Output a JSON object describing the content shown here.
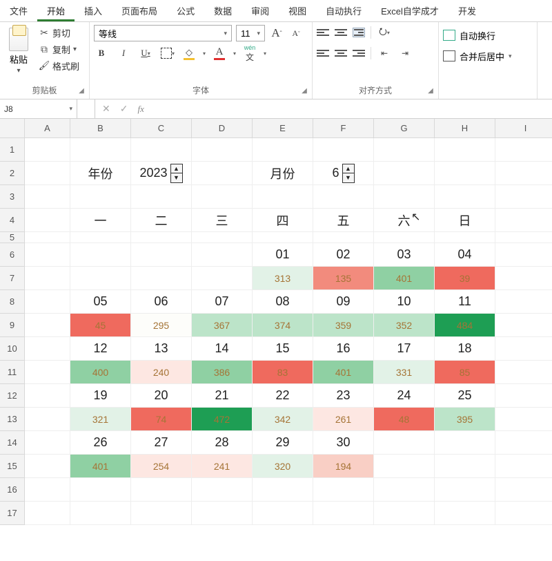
{
  "tabs": [
    "文件",
    "开始",
    "插入",
    "页面布局",
    "公式",
    "数据",
    "审阅",
    "视图",
    "自动执行",
    "Excel自学成才",
    "开发"
  ],
  "active_tab": "开始",
  "clipboard": {
    "paste": "粘贴",
    "cut": "剪切",
    "copy": "复制",
    "format_painter": "格式刷",
    "group": "剪贴板"
  },
  "font": {
    "name": "等线",
    "size": "11",
    "bold": "B",
    "italic": "I",
    "underline": "U",
    "wen": "wén",
    "wen2": "文",
    "group": "字体",
    "A": "A"
  },
  "align": {
    "group": "对齐方式",
    "wrap": "自动换行",
    "merge": "合并后居中"
  },
  "name_box": "J8",
  "fx_label": "fx",
  "columns": [
    "A",
    "B",
    "C",
    "D",
    "E",
    "F",
    "G",
    "H",
    "I"
  ],
  "rows": [
    "1",
    "2",
    "3",
    "4",
    "5",
    "6",
    "7",
    "8",
    "9",
    "10",
    "11",
    "12",
    "13",
    "14",
    "15",
    "16",
    "17"
  ],
  "sheet": {
    "year_label": "年份",
    "year_value": "2023",
    "month_label": "月份",
    "month_value": "6",
    "weekdays": [
      "一",
      "二",
      "三",
      "四",
      "五",
      "六",
      "日"
    ]
  },
  "calendar": [
    {
      "days": [
        "",
        "",
        "",
        "01",
        "02",
        "03",
        "04"
      ],
      "vals": [
        null,
        null,
        null,
        {
          "v": "313",
          "c": "g1"
        },
        {
          "v": "135",
          "c": "r4"
        },
        {
          "v": "401",
          "c": "g3"
        },
        {
          "v": "39",
          "c": "r5"
        }
      ]
    },
    {
      "days": [
        "05",
        "06",
        "07",
        "08",
        "09",
        "10",
        "11"
      ],
      "vals": [
        {
          "v": "45",
          "c": "r5"
        },
        {
          "v": "295",
          "c": "w0"
        },
        {
          "v": "367",
          "c": "g2"
        },
        {
          "v": "374",
          "c": "g2"
        },
        {
          "v": "359",
          "c": "g2"
        },
        {
          "v": "352",
          "c": "g2"
        },
        {
          "v": "484",
          "c": "g5"
        }
      ]
    },
    {
      "days": [
        "12",
        "13",
        "14",
        "15",
        "16",
        "17",
        "18"
      ],
      "vals": [
        {
          "v": "400",
          "c": "g3"
        },
        {
          "v": "240",
          "c": "r1"
        },
        {
          "v": "386",
          "c": "g3"
        },
        {
          "v": "83",
          "c": "r5"
        },
        {
          "v": "401",
          "c": "g3"
        },
        {
          "v": "331",
          "c": "g1"
        },
        {
          "v": "85",
          "c": "r5"
        }
      ]
    },
    {
      "days": [
        "19",
        "20",
        "21",
        "22",
        "23",
        "24",
        "25"
      ],
      "vals": [
        {
          "v": "321",
          "c": "g1"
        },
        {
          "v": "74",
          "c": "r5"
        },
        {
          "v": "472",
          "c": "g5"
        },
        {
          "v": "342",
          "c": "g1"
        },
        {
          "v": "261",
          "c": "r1"
        },
        {
          "v": "48",
          "c": "r5"
        },
        {
          "v": "395",
          "c": "g2"
        }
      ]
    },
    {
      "days": [
        "26",
        "27",
        "28",
        "29",
        "30",
        "",
        ""
      ],
      "vals": [
        {
          "v": "401",
          "c": "g3"
        },
        {
          "v": "254",
          "c": "r1"
        },
        {
          "v": "241",
          "c": "r1"
        },
        {
          "v": "320",
          "c": "g1"
        },
        {
          "v": "194",
          "c": "r2"
        },
        null,
        null
      ]
    }
  ]
}
